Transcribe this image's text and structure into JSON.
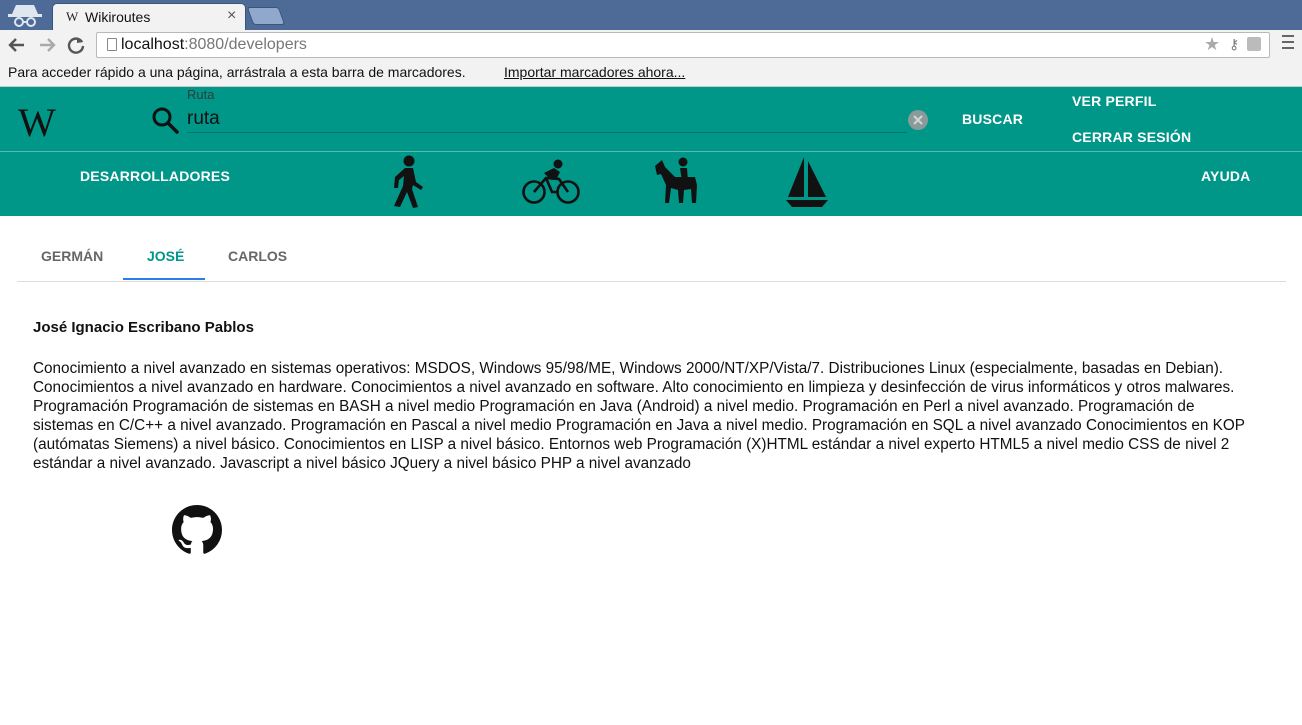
{
  "browser": {
    "tab_favicon": "W",
    "tab_title": "Wikiroutes",
    "tab_close": "×",
    "url_host": "localhost",
    "url_path": ":8080/developers",
    "bookmarks_text": "Para acceder rápido a una página, arrástrala a esta barra de marcadores.",
    "bookmarks_link": "Importar marcadores ahora..."
  },
  "header": {
    "logo": "W",
    "search_label": "Ruta",
    "search_value": "ruta",
    "search_button": "BUSCAR",
    "ver_perfil": "VER PERFIL",
    "cerrar_sesion": "CERRAR SESIÓN",
    "developers": "DESARROLLADORES",
    "help": "AYUDA",
    "accent_color": "#009688"
  },
  "modes": [
    "walking-icon",
    "cycling-icon",
    "horse-riding-icon",
    "sailing-icon"
  ],
  "tabs": [
    {
      "label": "GERMÁN",
      "active": false
    },
    {
      "label": "JOSÉ",
      "active": true
    },
    {
      "label": "CARLOS",
      "active": false
    }
  ],
  "developer": {
    "name": "José Ignacio Escribano Pablos",
    "description": "Conocimiento a nivel avanzado en sistemas operativos: MSDOS, Windows 95/98/ME, Windows 2000/NT/XP/Vista/7. Distribuciones Linux (especialmente, basadas en Debian). Conocimientos a nivel avanzado en hardware. Conocimientos a nivel avanzado en software. Alto conocimiento en limpieza y desinfección de virus informáticos y otros malwares. Programación Programación de sistemas en BASH a nivel medio Programación en Java (Android) a nivel medio. Programación en Perl a nivel avanzado. Programación de sistemas en C/C++ a nivel avanzado. Programación en Pascal a nivel medio Programación en Java a nivel medio. Programación en SQL a nivel avanzado Conocimientos en KOP (autómatas Siemens) a nivel básico. Conocimientos en LISP a nivel básico. Entornos web Programación (X)HTML estándar a nivel experto HTML5 a nivel medio CSS de nivel 2 estándar a nivel avanzado. Javascript a nivel básico JQuery a nivel básico PHP a nivel avanzado",
    "link_icon": "github-icon"
  }
}
